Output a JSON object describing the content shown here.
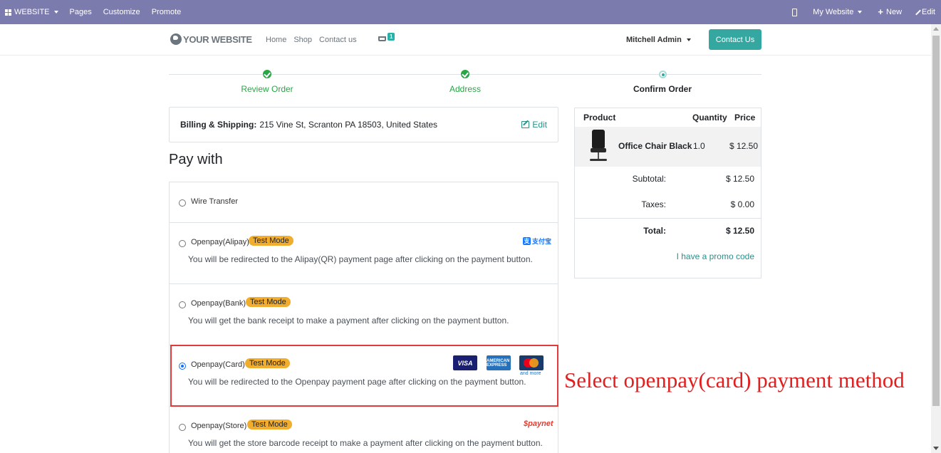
{
  "adminbar": {
    "apps_label": "WEBSITE",
    "menu": [
      "Pages",
      "Customize",
      "Promote"
    ],
    "my_website": "My Website",
    "new_label": "New",
    "edit_label": "Edit"
  },
  "header": {
    "logo_text": "YOUR WEBSITE",
    "nav": [
      "Home",
      "Shop",
      "Contact us"
    ],
    "cart_count": "1",
    "user": "Mitchell Admin",
    "contact_button": "Contact Us"
  },
  "steps": [
    {
      "label": "Review Order",
      "state": "done"
    },
    {
      "label": "Address",
      "state": "done"
    },
    {
      "label": "Confirm Order",
      "state": "current"
    }
  ],
  "address": {
    "label": "Billing & Shipping:",
    "value": "215 Vine St, Scranton PA 18503, United States",
    "edit": "Edit"
  },
  "pay_with_title": "Pay with",
  "payment_methods": [
    {
      "name": "Wire Transfer",
      "test_mode": "",
      "description": "",
      "selected": false
    },
    {
      "name": "Openpay(Alipay)",
      "test_mode": "Test Mode",
      "description": "You will be redirected to the Alipay(QR) payment page after clicking on the payment button.",
      "selected": false,
      "logo": "alipay-logo"
    },
    {
      "name": "Openpay(Bank)",
      "test_mode": "Test Mode",
      "description": "You will get the bank receipt to make a payment after clicking on the payment button.",
      "selected": false
    },
    {
      "name": "Openpay(Card)",
      "test_mode": "Test Mode",
      "description": "You will be redirected to the Openpay payment page after clicking on the payment button.",
      "selected": true,
      "logos": [
        "VISA",
        "AMERICAN EXPRESS",
        "MasterCard"
      ],
      "and_more": "and more"
    },
    {
      "name": "Openpay(Store)",
      "test_mode": "Test Mode",
      "description": "You will get the store barcode receipt to make a payment after clicking on the payment button.",
      "selected": false,
      "logo_text": "paynet"
    }
  ],
  "alipay_logo_text": "支付宝",
  "annotation": "Select openpay(card) payment method",
  "summary": {
    "headers": [
      "Product",
      "Quantity",
      "Price"
    ],
    "item": {
      "name": "Office Chair Black",
      "qty": "1.0",
      "price": "$ 12.50"
    },
    "subtotal_label": "Subtotal:",
    "subtotal": "$ 12.50",
    "taxes_label": "Taxes:",
    "taxes": "$ 0.00",
    "total_label": "Total:",
    "total": "$ 12.50",
    "promo": "I have a promo code"
  },
  "colors": {
    "adminbar": "#7c7bad",
    "accent": "#35a7a1",
    "success": "#28a745",
    "test_mode": "#f0ad2e",
    "highlight": "#e03a3a"
  }
}
